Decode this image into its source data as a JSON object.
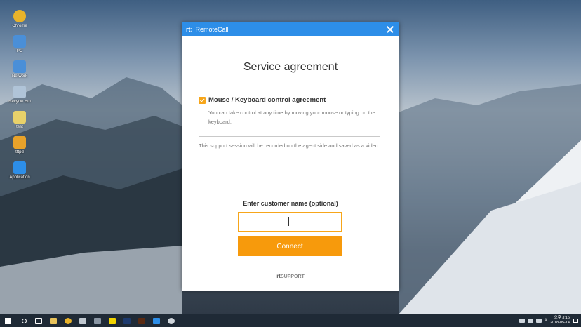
{
  "desktop": {
    "icons": [
      {
        "label": "Chrome",
        "color": "#e9b32a"
      },
      {
        "label": "PC",
        "color": "#4a8fd8"
      },
      {
        "label": "Network",
        "color": "#4a8fd8"
      },
      {
        "label": "Recycle Bin",
        "color": "#b0c4d8"
      },
      {
        "label": "test",
        "color": "#e8d16a"
      },
      {
        "label": "tftpd",
        "color": "#e8a22a"
      },
      {
        "label": "Application",
        "color": "#2d8ee8"
      }
    ]
  },
  "dialog": {
    "app_name": "RemoteCall",
    "logo": "rt:",
    "heading": "Service agreement",
    "agreement": {
      "checked": true,
      "title": "Mouse / Keyboard control agreement",
      "description": "You can take control at any time by moving your mouse or typing on the keyboard."
    },
    "record_note": "This support session will be recorded on the agent side and saved as a video.",
    "name_label": "Enter customer name (optional)",
    "name_value": "",
    "connect_label": "Connect",
    "brand_mark": "rt",
    "brand_text": "SUPPORT",
    "accent": "#2d8ee8",
    "button_color": "#f79a0c"
  },
  "taskbar": {
    "apps": [
      {
        "name": "file-explorer-icon",
        "color": "#e8c25a"
      },
      {
        "name": "chrome-icon",
        "color": "#e9b32a"
      },
      {
        "name": "eraser-icon",
        "color": "#c0c8d0"
      },
      {
        "name": "calculator-icon",
        "color": "#8a96a4"
      },
      {
        "name": "kakaotalk-icon",
        "color": "#f2d400"
      },
      {
        "name": "photoshop-icon",
        "color": "#1d3a6e"
      },
      {
        "name": "illustrator-icon",
        "color": "#5a2a12"
      },
      {
        "name": "remotecall-icon",
        "color": "#2d8ee8"
      },
      {
        "name": "settings-icon",
        "color": "#d0d6dc"
      }
    ],
    "ime": "A",
    "time": "오후 3:16",
    "date": "2018-05-14"
  }
}
